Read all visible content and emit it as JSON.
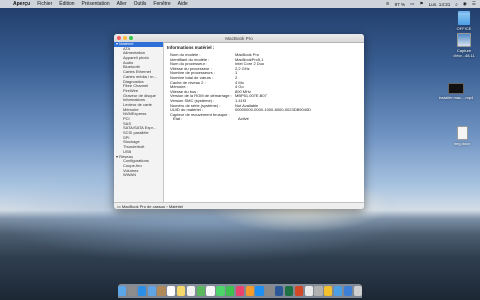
{
  "menubar": {
    "app_name": "Aperçu",
    "items": [
      "Fichier",
      "Édition",
      "Présentation",
      "Aller",
      "Outils",
      "Fenêtre",
      "Aide"
    ],
    "battery": "97 %",
    "clock": "Lun. 14:31"
  },
  "desktop_icons": [
    {
      "label": "OFFICE",
      "icon": "folder-icon"
    },
    {
      "label": "Capture d'écr...48.11",
      "icon": "image-thumbnail-icon"
    },
    {
      "label": "installer.mac....mp4",
      "icon": "video-thumbnail-icon"
    },
    {
      "label": "neg.docx",
      "icon": "document-icon"
    }
  ],
  "window": {
    "title": "MacBook Pro",
    "content_heading": "Informations matériel :",
    "path": "MacBook Pro de cassou › Matériel"
  },
  "sidebar": {
    "groups": [
      {
        "label": "Matériel",
        "selected": true,
        "items": [
          "ATA",
          "Alimentation",
          "Appareil photo",
          "Audio",
          "Bluetooth",
          "Cartes Ethernet",
          "Cartes média / m...",
          "Diagnostics",
          "Fibre Channel",
          "FireWire",
          "Graveur de disque",
          "Informations",
          "Lecteur de carte",
          "Mémoire",
          "NVMExpress",
          "PCI",
          "SAS",
          "SATA/SATA Expr...",
          "SCSI parallèle",
          "SPI",
          "Stockage",
          "Thunderbolt",
          "USB"
        ]
      },
      {
        "label": "Réseau",
        "selected": false,
        "items": [
          "Configurations",
          "Coupe-feu",
          "Volumes",
          "WWAN"
        ]
      }
    ]
  },
  "hardware_info": [
    {
      "key": "Nom du modèle :",
      "value": "MacBook Pro",
      "sub": false
    },
    {
      "key": "Identifiant du modèle :",
      "value": "MacBookPro5,1",
      "sub": false
    },
    {
      "key": "Nom du processeur :",
      "value": "Intel Core 2 Duo",
      "sub": false
    },
    {
      "key": "Vitesse du processeur :",
      "value": "2,2 GHz",
      "sub": false
    },
    {
      "key": "Nombre de processeurs :",
      "value": "1",
      "sub": false
    },
    {
      "key": "Nombre total de cœurs :",
      "value": "2",
      "sub": false
    },
    {
      "key": "Cache de niveau 2 :",
      "value": "4 Mo",
      "sub": false
    },
    {
      "key": "Mémoire :",
      "value": "4 Go",
      "sub": false
    },
    {
      "key": "Vitesse du bus :",
      "value": "800 MHz",
      "sub": false
    },
    {
      "key": "Version de la ROM de démarrage :",
      "value": "MBP51.007E.B07",
      "sub": false
    },
    {
      "key": "Version SMC (système) :",
      "value": "1.41f3",
      "sub": false
    },
    {
      "key": "Numéro de série (système) :",
      "value": "Not Available",
      "sub": false
    },
    {
      "key": "UUID du matériel :",
      "value": "00000000-0000-1000-8000-0023DB9040D",
      "sub": false
    },
    {
      "key": "Capteur de mouvement brusque :",
      "value": "",
      "sub": false
    },
    {
      "key": "État :",
      "value": "Activé",
      "sub": true
    }
  ],
  "dock": {
    "apps": [
      "finder-icon",
      "launchpad-icon",
      "safari-icon",
      "mail-icon",
      "contacts-icon",
      "calendar-icon",
      "notes-icon",
      "reminders-icon",
      "maps-icon",
      "photos-icon",
      "messages-icon",
      "facetime-icon",
      "itunes-icon",
      "ibooks-icon",
      "app-store-icon",
      "system-preferences-icon",
      "word-icon",
      "excel-icon",
      "powerpoint-icon",
      "preview-icon",
      "system-information-icon",
      "chrome-icon",
      "folder-icon",
      "downloads-stack-icon",
      "trash-icon"
    ],
    "colors": [
      "#5aa6e8",
      "#8d8d8d",
      "#2d8ee6",
      "#5fa5e6",
      "#b08a5a",
      "#ffffff",
      "#f5d86a",
      "#f2f2f2",
      "#5cb85c",
      "#f7f7f7",
      "#4fd36b",
      "#3ec14f",
      "#e8426d",
      "#f39c2c",
      "#1d8ff0",
      "#8a8a8a",
      "#2b5797",
      "#1e7145",
      "#d24726",
      "#e9e9e9",
      "#b0b0b0",
      "#f2c02c",
      "#4a9fe5",
      "#3d7fd6",
      "#cfcfcf"
    ]
  }
}
